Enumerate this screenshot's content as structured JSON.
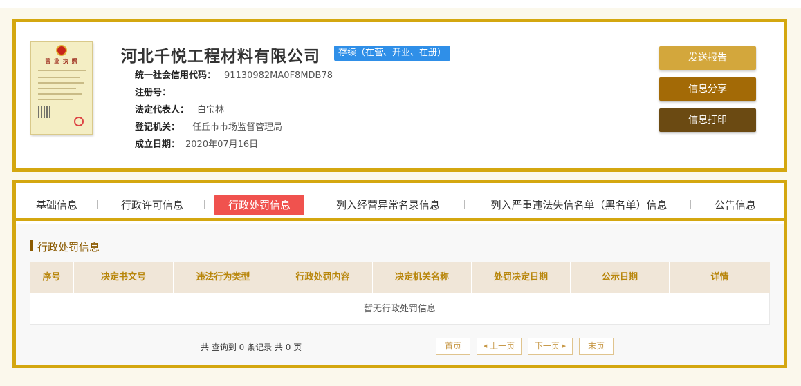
{
  "company": {
    "name": "河北千悦工程材料有限公司",
    "status": "存续（在营、开业、在册）",
    "license_title": "营 业 执 照",
    "fields": [
      {
        "key": "统一社会信用代码：",
        "value": "91130982MA0F8MDB78"
      },
      {
        "key": "注册号：",
        "value": ""
      },
      {
        "key": "法定代表人：",
        "value": "白宝林"
      },
      {
        "key": "登记机关：",
        "value": "任丘市市场监督管理局"
      },
      {
        "key": "成立日期：",
        "value": "2020年07月16日"
      }
    ]
  },
  "actions": {
    "report": "发送报告",
    "share": "信息分享",
    "print": "信息打印"
  },
  "tabs": [
    {
      "label": "基础信息"
    },
    {
      "label": "行政许可信息"
    },
    {
      "label": "行政处罚信息"
    },
    {
      "label": "列入经营异常名录信息"
    },
    {
      "label": "列入严重违法失信名单（黑名单）信息"
    },
    {
      "label": "公告信息"
    }
  ],
  "section": {
    "title": "行政处罚信息",
    "columns": [
      "序号",
      "决定书文号",
      "违法行为类型",
      "行政处罚内容",
      "决定机关名称",
      "处罚决定日期",
      "公示日期",
      "详情"
    ],
    "empty_text": "暂无行政处罚信息"
  },
  "pager": {
    "info": "共 查询到 0 条记录 共 0 页",
    "first": "首页",
    "prev": "上一页",
    "next": "下一页",
    "last": "末页"
  },
  "colors": {
    "frame": "#d4a710",
    "active_tab": "#f0524e",
    "status_badge": "#2f8fe8",
    "header_text": "#b8860b"
  }
}
